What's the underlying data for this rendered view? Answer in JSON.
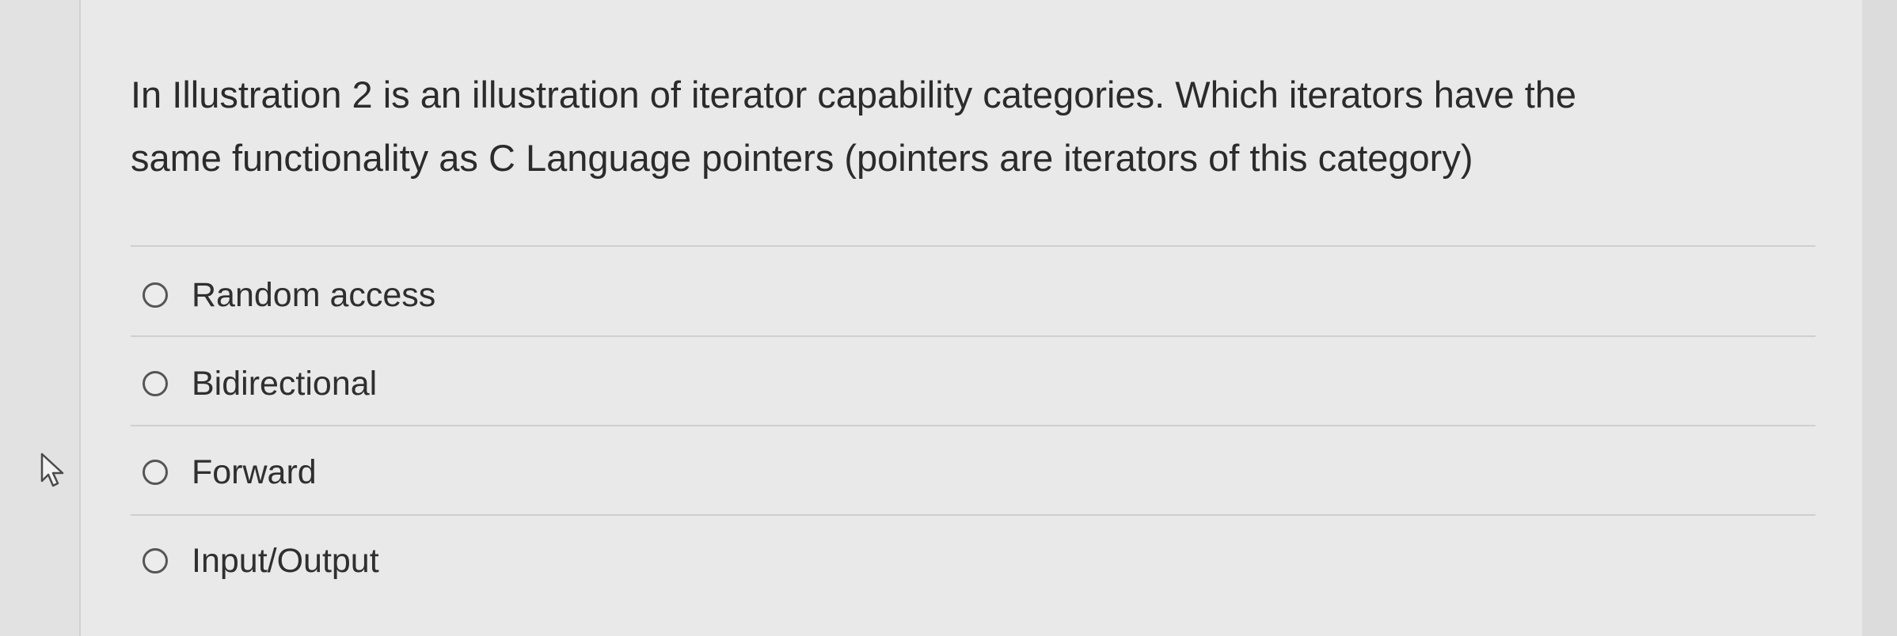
{
  "question": {
    "line1": "In Illustration 2 is an illustration of iterator capability categories.  Which iterators have the",
    "line2": "same functionality as C Language pointers (pointers are iterators of this category)"
  },
  "options": [
    {
      "label": "Random access",
      "selected": false
    },
    {
      "label": "Bidirectional",
      "selected": false
    },
    {
      "label": "Forward",
      "selected": false
    },
    {
      "label": "Input/Output",
      "selected": false
    }
  ],
  "icons": {
    "cursor": "mouse-pointer-icon",
    "radio": "radio-button-icon"
  },
  "colors": {
    "panel_background": "#e9e9e9",
    "text": "#2f2f2f",
    "divider": "#cfcfcf"
  }
}
